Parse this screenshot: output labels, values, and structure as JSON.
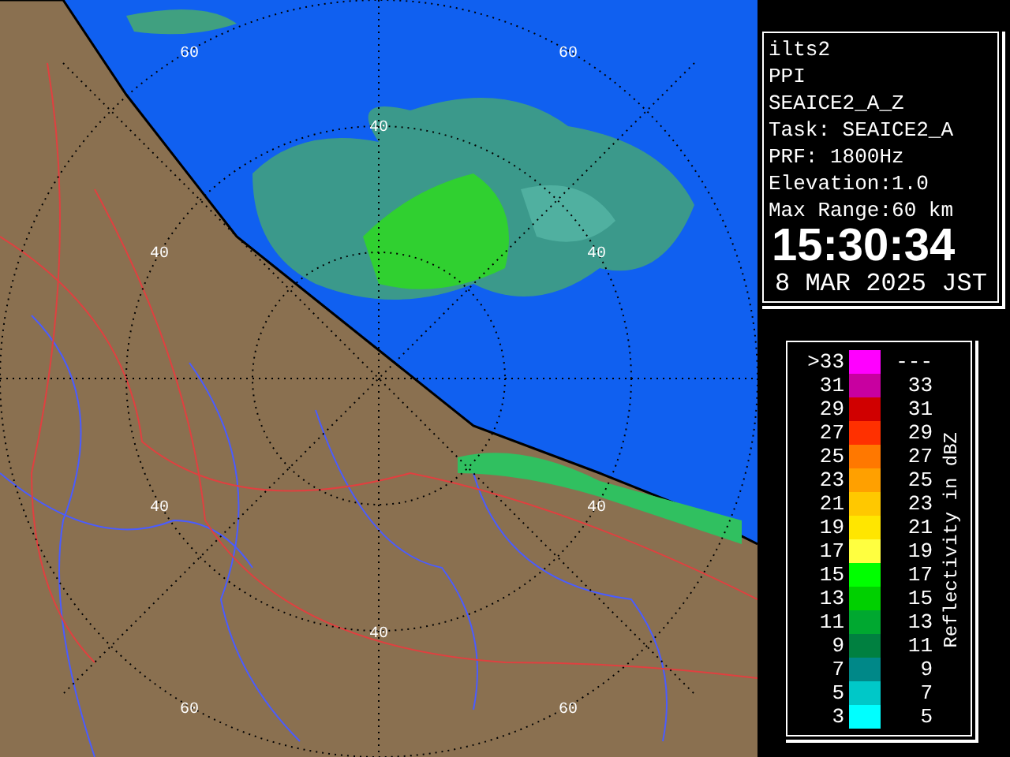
{
  "map": {
    "range_labels": [
      "60",
      "60",
      "40",
      "40",
      "40",
      "40",
      "40",
      "40",
      "60",
      "60"
    ]
  },
  "info": {
    "lines": [
      "ilts2",
      "PPI",
      "SEAICE2_A_Z",
      "Task: SEAICE2_A",
      "PRF: 1800Hz",
      "Elevation:1.0",
      "Max Range:60 km"
    ],
    "time": "15:30:34",
    "date": "8 MAR 2025 JST"
  },
  "legend": {
    "title": "Reflectivity in dBZ",
    "rows": [
      {
        "low": ">33",
        "high": "---",
        "color": "#ff00ff"
      },
      {
        "low": "31",
        "high": "33",
        "color": "#c800a0"
      },
      {
        "low": "29",
        "high": "31",
        "color": "#d00000"
      },
      {
        "low": "27",
        "high": "29",
        "color": "#ff3000"
      },
      {
        "low": "25",
        "high": "27",
        "color": "#ff7800"
      },
      {
        "low": "23",
        "high": "25",
        "color": "#ffa000"
      },
      {
        "low": "21",
        "high": "23",
        "color": "#ffc800"
      },
      {
        "low": "19",
        "high": "21",
        "color": "#ffe600"
      },
      {
        "low": "17",
        "high": "19",
        "color": "#ffff40"
      },
      {
        "low": "15",
        "high": "17",
        "color": "#00ff00"
      },
      {
        "low": "13",
        "high": "15",
        "color": "#00d000"
      },
      {
        "low": "11",
        "high": "13",
        "color": "#00a830"
      },
      {
        "low": "9",
        "high": "11",
        "color": "#008040"
      },
      {
        "low": "7",
        "high": "9",
        "color": "#008888"
      },
      {
        "low": "5",
        "high": "7",
        "color": "#00c8c8"
      },
      {
        "low": "3",
        "high": "5",
        "color": "#00ffff"
      }
    ]
  }
}
